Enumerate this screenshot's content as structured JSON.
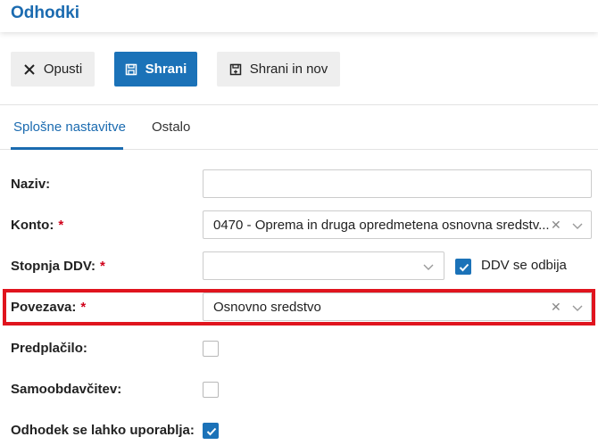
{
  "header": {
    "title": "Odhodki"
  },
  "toolbar": {
    "cancel_label": "Opusti",
    "save_label": "Shrani",
    "save_new_label": "Shrani in nov"
  },
  "tabs": [
    {
      "label": "Splošne nastavitve",
      "active": true
    },
    {
      "label": "Ostalo",
      "active": false
    }
  ],
  "form": {
    "naziv": {
      "label": "Naziv:",
      "value": ""
    },
    "konto": {
      "label": "Konto:",
      "required_mark": "*",
      "value": "0470 - Oprema in druga opredmetena osnovna sredstv..."
    },
    "stopnja_ddv": {
      "label": "Stopnja DDV:",
      "required_mark": "*",
      "value": ""
    },
    "ddv_se_odbija": {
      "label": "DDV se odbija",
      "checked": true
    },
    "povezava": {
      "label": "Povezava:",
      "required_mark": "*",
      "value": "Osnovno sredstvo"
    },
    "predplacilo": {
      "label": "Predplačilo:",
      "checked": false
    },
    "samoobdavcitev": {
      "label": "Samoobdavčitev:",
      "checked": false
    },
    "uporablja": {
      "label": "Odhodek se lahko uporablja:",
      "checked": true
    }
  },
  "colors": {
    "accent": "#1b72b8",
    "title": "#1b6bb0",
    "required": "#d0021b",
    "highlight": "#e0141e"
  },
  "icons": {
    "cancel": "close-icon",
    "save": "floppy-disk-icon",
    "save_new": "floppy-disk-plus-icon",
    "clear": "clear-x-icon",
    "dropdown": "chevron-down-icon",
    "check": "checkmark-icon"
  }
}
